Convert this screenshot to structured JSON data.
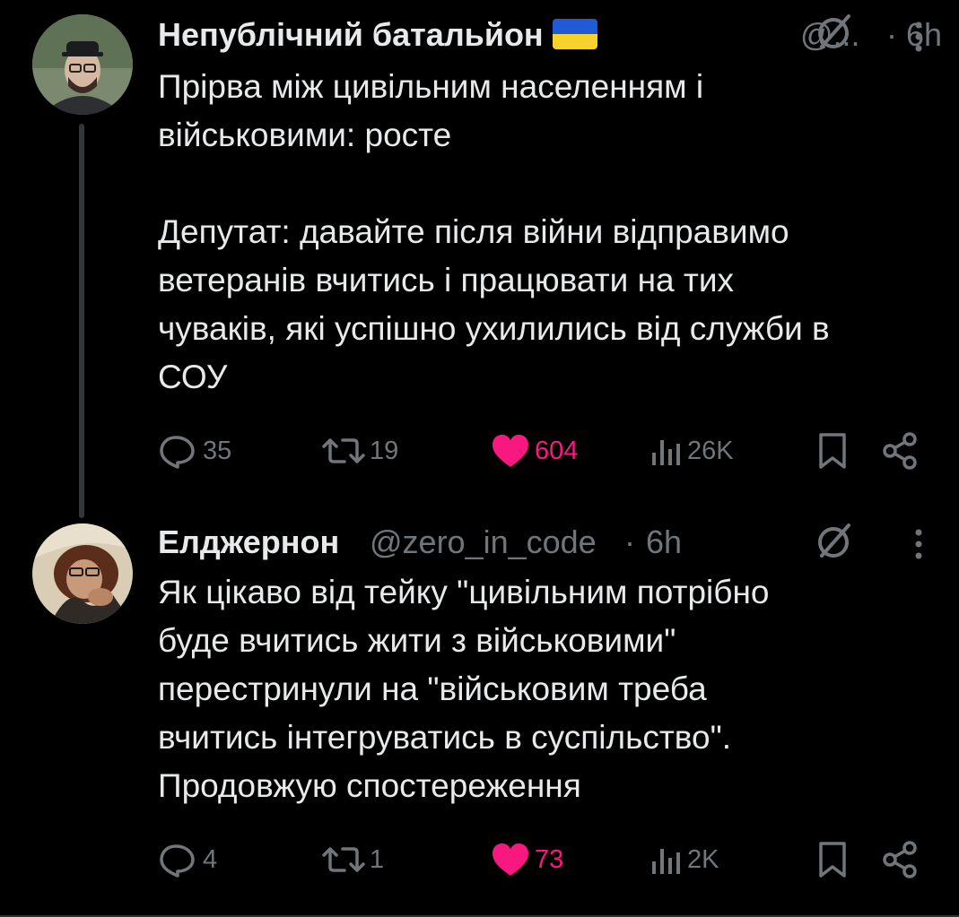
{
  "tweets": [
    {
      "name": "Непублічний батальйон",
      "flag": "ukraine-flag",
      "handle": "@...",
      "separator": "·",
      "time": "6h",
      "text": "Прірва між цивільним населенням і\nвійськовими: росте\n\nДепутат: давайте після війни відправимо\nветеранів вчитись і працювати на тих\nчуваків, які успішно ухилились від служби в\nСОУ",
      "replies": "35",
      "reposts": "19",
      "likes": "604",
      "views": "26K"
    },
    {
      "name": "Елджернон",
      "handle": "@zero_in_code",
      "separator": "·",
      "time": "6h",
      "text": "Як цікаво від тейку \"цивільним потрібно\nбуде вчитись жити з військовими\"\nперестринули на \"військовим треба\nвчитись інтегруватись в суспільство\".\nПродовжую спостереження",
      "replies": "4",
      "reposts": "1",
      "likes": "73",
      "views": "2K"
    }
  ],
  "colors": {
    "background": "#000000",
    "text": "#e7e9ea",
    "secondary": "#71767b",
    "like": "#f91880",
    "thread_line": "#333639"
  }
}
